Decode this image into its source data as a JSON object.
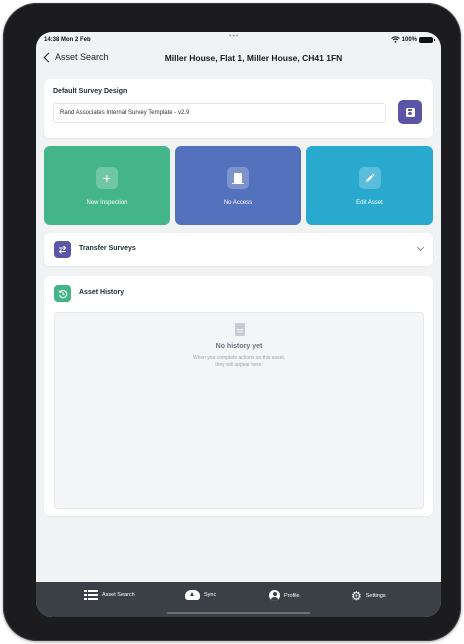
{
  "status_bar": {
    "time": "14:38  Mon 2 Feb",
    "dots": "•••",
    "battery": "100%"
  },
  "nav": {
    "back_label": "Asset Search",
    "title": "Miller House, Flat 1, Miller House, CH41 1FN"
  },
  "survey_design": {
    "title": "Default Survey Design",
    "value": "Rand Associates Internal Survey Template - v2.9"
  },
  "actions": {
    "new_inspection": "New Inspection",
    "no_access": "No Access",
    "edit_asset": "Edit Asset",
    "plus_glyph": "+",
    "colors": {
      "new": "#44b489",
      "no_access": "#5471bd",
      "edit": "#2aa9cf"
    }
  },
  "transfer": {
    "label": "Transfer Surveys"
  },
  "history": {
    "title": "Asset History",
    "empty_title": "No history yet",
    "empty_line1": "When you complete actions on this asset,",
    "empty_line2": "they will appear here."
  },
  "tab_bar": {
    "asset_search": "Asset Search",
    "sync": "Sync",
    "profile": "Profile",
    "settings": "Settings",
    "gear_glyph": "⚙"
  },
  "icons": [
    "chevron-left-icon",
    "save-icon",
    "plus-icon",
    "door-icon",
    "pencil-icon",
    "transfer-icon",
    "chevron-down-icon",
    "history-icon",
    "document-icon",
    "list-icon",
    "cloud-upload-icon",
    "user-circle-icon",
    "gear-icon"
  ]
}
